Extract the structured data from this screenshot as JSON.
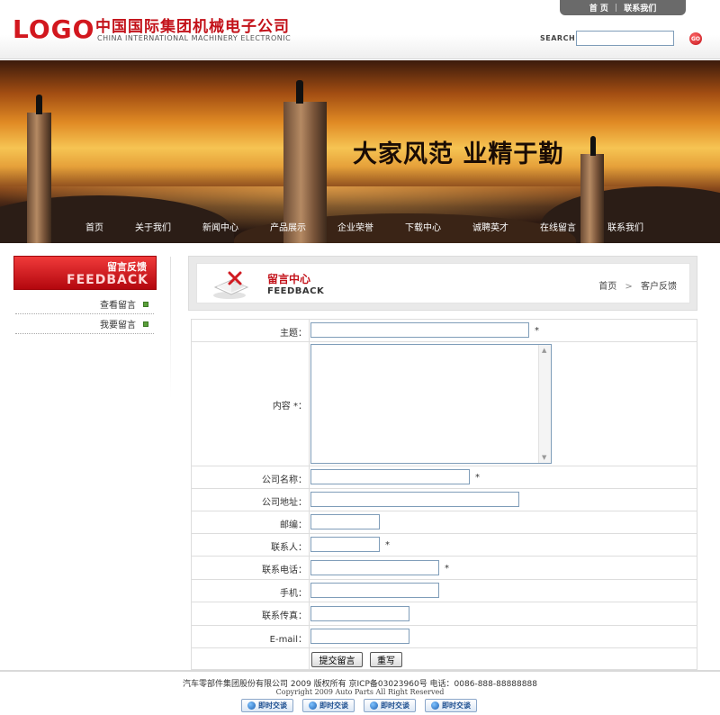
{
  "header": {
    "logo": "LOGO",
    "company_cn": "中国国际集团机械电子公司",
    "company_en": "CHINA INTERNATIONAL MACHINERY ELECTRONIC",
    "top_nav": [
      "首 页",
      "联系我们"
    ],
    "search_label": "SEARCH",
    "search_value": "",
    "go_label": "GO"
  },
  "banner": {
    "slogan": "大家风范 业精于勤"
  },
  "main_nav": [
    "首页",
    "关于我们",
    "新闻中心",
    "产品展示",
    "企业荣誉",
    "下载中心",
    "诚聘英才",
    "在线留言",
    "联系我们"
  ],
  "sidebar": {
    "title": "留言反馈",
    "title_en": "FEEDBACK",
    "items": [
      "查看留言",
      "我要留言"
    ]
  },
  "content": {
    "title": "留言中心",
    "title_en": "FEEDBACK",
    "breadcrumb": [
      "首页",
      "客户反馈"
    ]
  },
  "form": {
    "fields": [
      {
        "label": "主题：",
        "required": "*",
        "value": ""
      },
      {
        "label": "内容 *：",
        "value": ""
      },
      {
        "label": "公司名称：",
        "required": "*",
        "value": ""
      },
      {
        "label": "公司地址：",
        "value": ""
      },
      {
        "label": "邮编：",
        "value": ""
      },
      {
        "label": "联系人：",
        "required": "*",
        "value": ""
      },
      {
        "label": "联系电话：",
        "required": "*",
        "value": ""
      },
      {
        "label": "手机：",
        "value": ""
      },
      {
        "label": "联系传真：",
        "value": ""
      },
      {
        "label": "E-mail：",
        "value": ""
      }
    ],
    "submit_label": "提交留言",
    "reset_label": "重写"
  },
  "footer": {
    "line1": "汽车零部件集团股份有限公司 2009 版权所有 京ICP备03023960号 电话：0086-888-88888888",
    "line2": "Copyright 2009 Auto Parts All Right Reserved",
    "chat_label": "即时交谈",
    "chat_count": 4
  },
  "colors": {
    "brand_red": "#c3121a",
    "input_border": "#7f9db9",
    "table_border": "#dddddd"
  },
  "icons": [
    "search-icon",
    "go-icon",
    "feedback-book-icon",
    "breadcrumb-chevron-icon",
    "chat-icon"
  ]
}
